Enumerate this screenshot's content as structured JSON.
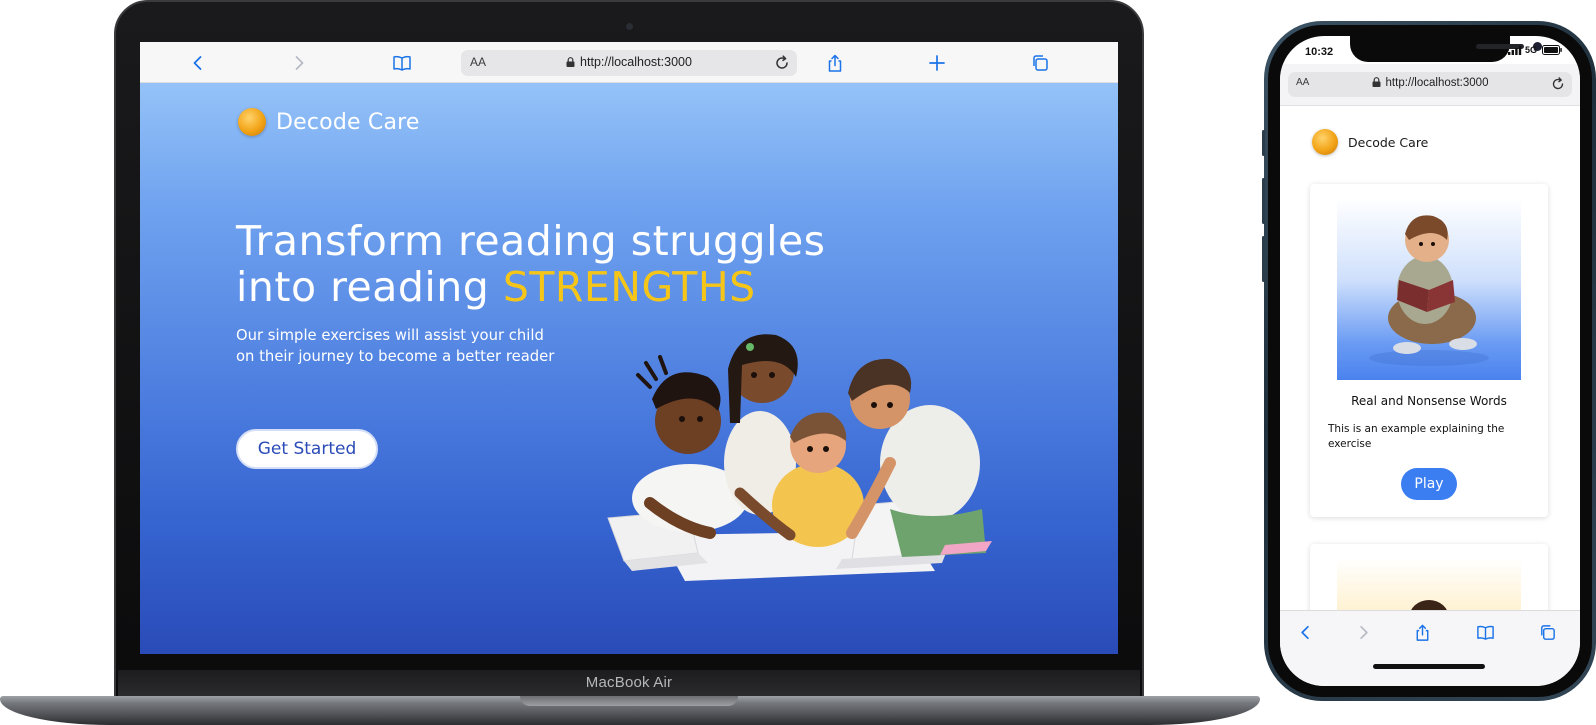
{
  "laptop": {
    "device_label": "MacBook Air",
    "browser": {
      "text_size_label": "AA",
      "url": "http://localhost:3000"
    },
    "site": {
      "brand_name": "Decode Care",
      "headline_line1": "Transform reading struggles",
      "headline_line2_prefix": "into reading ",
      "headline_highlight": "STRENGTHS",
      "subtitle_line1": "Our simple exercises will assist your child",
      "subtitle_line2": "on their journey to become a better reader",
      "cta_label": "Get Started"
    }
  },
  "phone": {
    "status": {
      "time": "10:32",
      "network": "5G"
    },
    "browser": {
      "text_size_label": "AA",
      "url": "http://localhost:3000"
    },
    "site": {
      "brand_name": "Decode Care",
      "exercise_card": {
        "title": "Real and Nonsense Words",
        "description": "This is an example explaining the exercise",
        "play_label": "Play"
      }
    }
  },
  "colors": {
    "accent_blue": "#3b7ef2",
    "highlight_yellow": "#f5c518",
    "hero_top": "#94c2f8",
    "hero_bottom": "#2a4bb8",
    "safari_icon_blue": "#1a73e8"
  },
  "icons": {
    "laptop_toolbar": [
      "back-icon",
      "forward-icon",
      "bookmarks-icon",
      "share-icon",
      "new-tab-icon",
      "tabs-icon"
    ],
    "phone_toolbar": [
      "back-icon",
      "forward-icon",
      "share-icon",
      "bookmarks-icon",
      "tabs-icon"
    ]
  }
}
